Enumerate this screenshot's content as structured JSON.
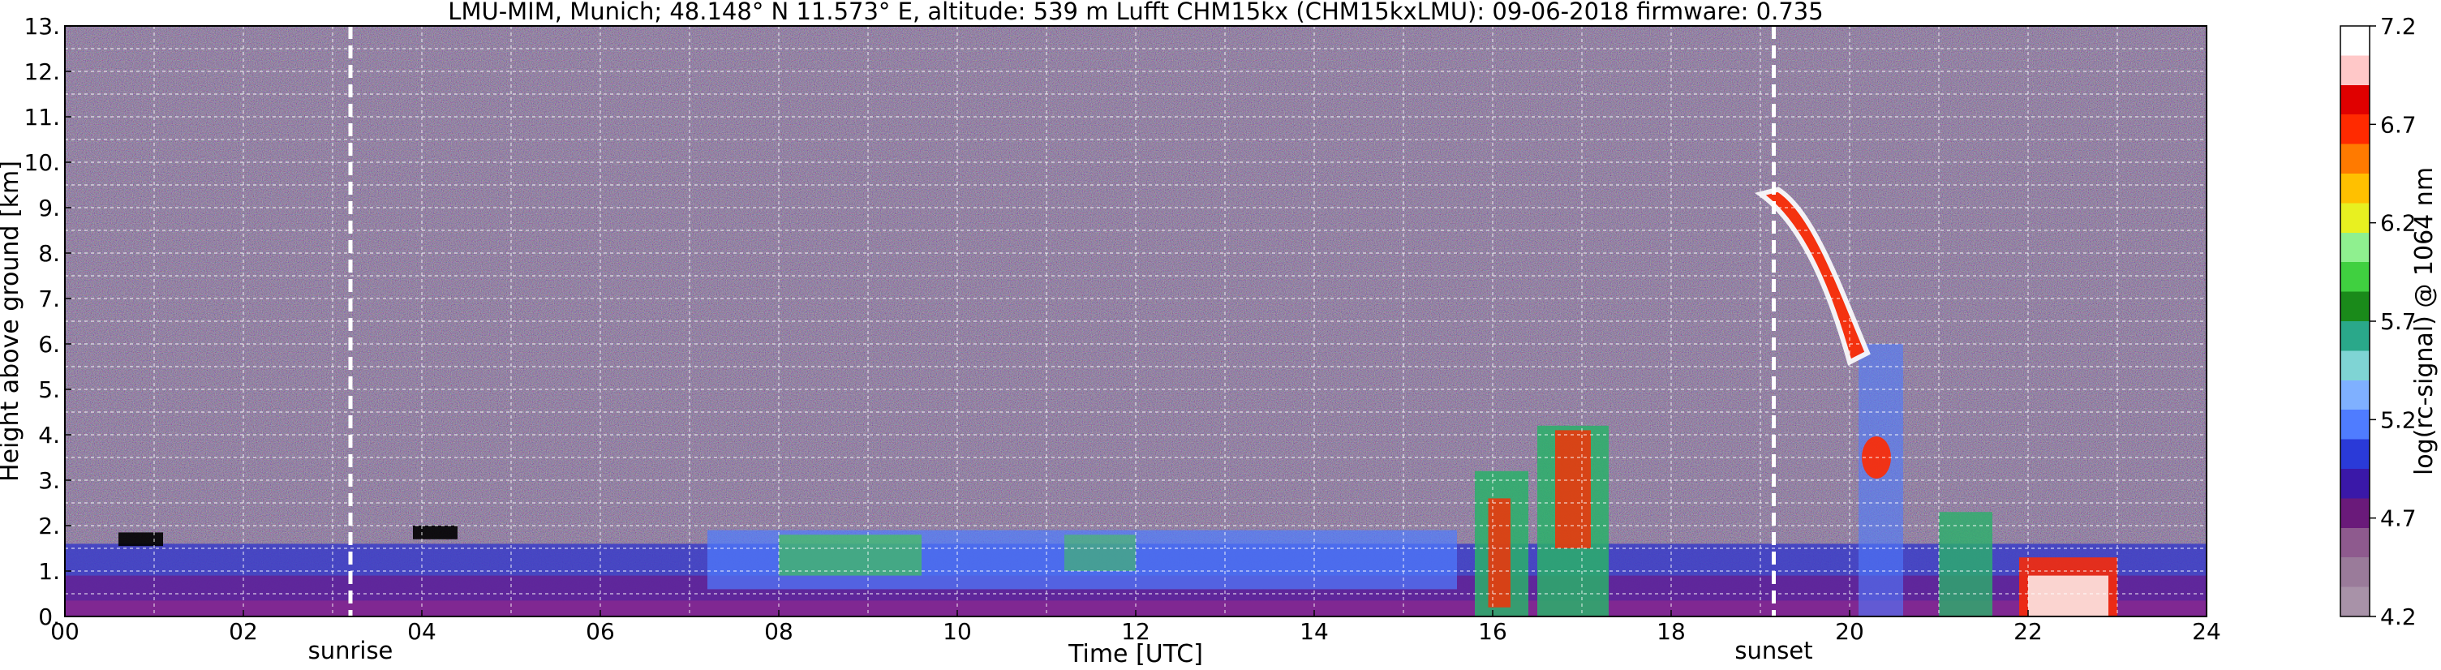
{
  "chart_data": {
    "type": "heatmap",
    "title": "LMU-MIM, Munich; 48.148° N 11.573° E, altitude: 539 m    Lufft CHM15kx (CHM15kxLMU): 09-06-2018    firmware: 0.735",
    "xlabel": "Time [UTC]",
    "ylabel": "Height above ground [km]",
    "xlim": [
      0,
      24
    ],
    "ylim": [
      0,
      13
    ],
    "x_ticks": [
      "00",
      "02",
      "04",
      "06",
      "08",
      "10",
      "12",
      "14",
      "16",
      "18",
      "20",
      "22",
      "24"
    ],
    "y_ticks": [
      "0.",
      "1.",
      "2.",
      "3.",
      "4.",
      "5.",
      "6.",
      "7.",
      "8.",
      "9.",
      "10.",
      "11.",
      "12.",
      "13."
    ],
    "grid": true,
    "colorbar": {
      "label": "log(rc-signal) @ 1064 nm",
      "range": [
        4.2,
        7.2
      ],
      "ticks": [
        "4.2",
        "4.7",
        "5.2",
        "5.7",
        "6.2",
        "6.7",
        "7.2"
      ],
      "colors": [
        "#a892a8",
        "#9a7b9a",
        "#8e5a8e",
        "#6a1a7a",
        "#3a18a8",
        "#2a3ad8",
        "#4f7cff",
        "#7fb0ff",
        "#7fd4d4",
        "#2aa88a",
        "#1a8a1a",
        "#40d040",
        "#8ff08f",
        "#e8f020",
        "#ffc000",
        "#ff7a00",
        "#ff2a00",
        "#e00000",
        "#ffc8c8",
        "#ffffff"
      ]
    },
    "events": [
      {
        "label": "sunrise",
        "x": 3.2
      },
      {
        "label": "sunset",
        "x": 19.15
      }
    ],
    "features": [
      {
        "kind": "boundary-layer",
        "x": [
          0,
          24
        ],
        "y": [
          0,
          1.7
        ]
      },
      {
        "kind": "aerosol-layers",
        "x": [
          7.2,
          15.5
        ],
        "y": [
          0.6,
          2.2
        ]
      },
      {
        "kind": "convective-clouds",
        "x": [
          15.8,
          17.6
        ],
        "y": [
          0,
          4.2
        ]
      },
      {
        "kind": "descending-cloud",
        "x": [
          19.0,
          20.5
        ],
        "y": [
          3.2,
          9.4
        ]
      },
      {
        "kind": "low-clouds",
        "x": [
          21.0,
          23.4
        ],
        "y": [
          0,
          2.7
        ]
      }
    ]
  }
}
